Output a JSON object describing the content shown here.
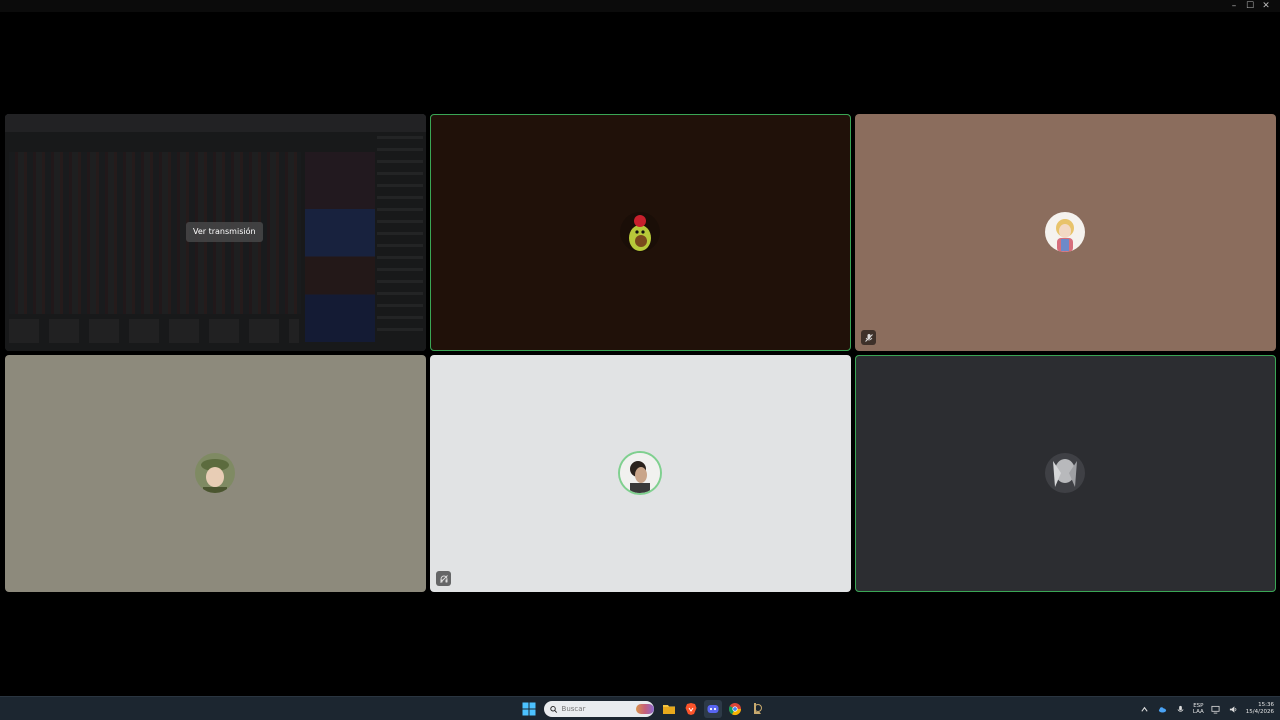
{
  "window": {
    "controls": {
      "minimize": "–",
      "maximize": "☐",
      "close": "✕"
    }
  },
  "tiles": [
    {
      "kind": "stream",
      "bg": "#2a2b2d",
      "speaking": false,
      "watch_label": "Ver transmisión"
    },
    {
      "kind": "participant",
      "bg": "#201109",
      "speaking": true,
      "avatar": "avocado-avatar",
      "status_icon": null
    },
    {
      "kind": "participant",
      "bg": "#8b6d5d",
      "speaking": false,
      "avatar": "anime-girl-avatar",
      "status_icon": "muted-mic-icon"
    },
    {
      "kind": "participant",
      "bg": "#8d8a7c",
      "speaking": false,
      "avatar": "person-hat-avatar",
      "status_icon": null
    },
    {
      "kind": "participant",
      "bg": "#e1e3e4",
      "speaking": false,
      "avatar": "person-profile-avatar",
      "status_icon": "headphones-off-icon"
    },
    {
      "kind": "participant",
      "bg": "#2c2d31",
      "speaking": true,
      "avatar": "grey-figure-avatar",
      "status_icon": null
    }
  ],
  "taskbar": {
    "search_placeholder": "Buscar",
    "apps": [
      "windows-start-icon",
      "file-explorer-icon",
      "brave-browser-icon",
      "discord-icon",
      "chrome-icon",
      "league-client-icon"
    ],
    "tray": {
      "lang_line1": "ESP",
      "lang_line2": "LAA",
      "time": "15:36",
      "date": "15/4/2026"
    }
  },
  "colors": {
    "speaking_outline": "#3aa655",
    "taskbar_bg": "#1c2630",
    "stage_bg": "#000000"
  }
}
